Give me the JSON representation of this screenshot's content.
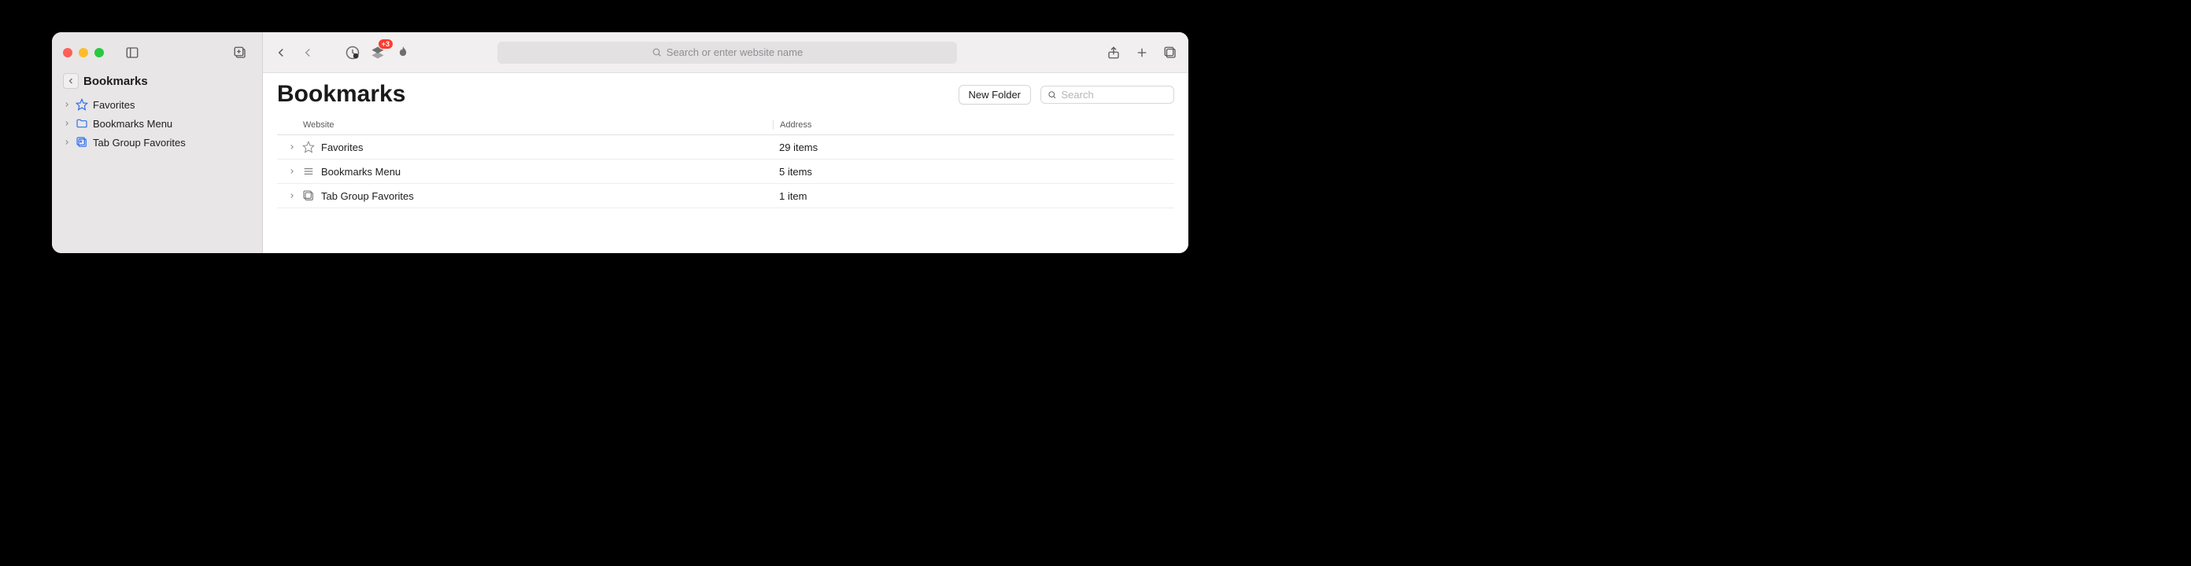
{
  "sidebar": {
    "title": "Bookmarks",
    "items": [
      {
        "label": "Favorites",
        "icon": "star"
      },
      {
        "label": "Bookmarks Menu",
        "icon": "folder"
      },
      {
        "label": "Tab Group Favorites",
        "icon": "tabgroup"
      }
    ]
  },
  "toolbar": {
    "address_placeholder": "Search or enter website name",
    "badge": "+3"
  },
  "page": {
    "title": "Bookmarks",
    "new_folder_label": "New Folder",
    "search_placeholder": "Search"
  },
  "table": {
    "headers": {
      "website": "Website",
      "address": "Address"
    },
    "rows": [
      {
        "label": "Favorites",
        "count": "29 items",
        "icon": "star"
      },
      {
        "label": "Bookmarks Menu",
        "count": "5 items",
        "icon": "menu"
      },
      {
        "label": "Tab Group Favorites",
        "count": "1 item",
        "icon": "tabgroup"
      }
    ]
  }
}
